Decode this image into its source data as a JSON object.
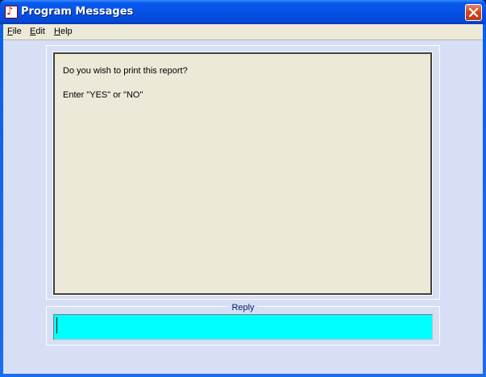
{
  "window": {
    "title": "Program Messages",
    "icon": "app-icon"
  },
  "menubar": {
    "items": [
      {
        "label": "File",
        "accel": "F",
        "rest": "ile"
      },
      {
        "label": "Edit",
        "accel": "E",
        "rest": "dit"
      },
      {
        "label": "Help",
        "accel": "H",
        "rest": "elp"
      }
    ]
  },
  "message": {
    "lines": [
      "Do you wish to print this report?",
      "Enter \"YES\" or \"NO\""
    ]
  },
  "reply": {
    "label": "Reply",
    "value": ""
  },
  "colors": {
    "titlebar": "#0553e6",
    "client": "#d6dff5",
    "message_bg": "#ece9d8",
    "reply_bg": "#00ffff",
    "close_button": "#d4441e"
  }
}
